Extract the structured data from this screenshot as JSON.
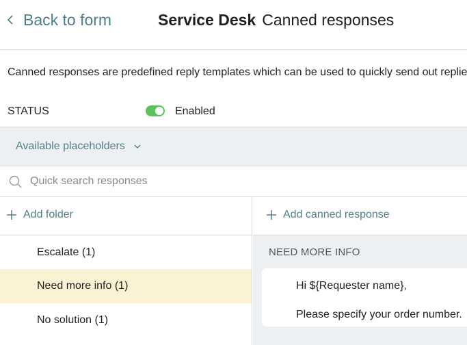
{
  "header": {
    "back_label": "Back to form",
    "product_name": "Service Desk",
    "page_title": "Canned responses"
  },
  "description": "Canned responses are predefined reply templates which can be used to quickly send out replies.",
  "status": {
    "label": "STATUS",
    "value": "Enabled",
    "enabled": true,
    "toggle_color": "#5cc15a"
  },
  "placeholders": {
    "label": "Available placeholders"
  },
  "search": {
    "placeholder": "Quick search responses",
    "value": ""
  },
  "folders": {
    "add_label": "Add folder",
    "items": [
      {
        "label": "Escalate (1)"
      },
      {
        "label": "Need more info (1)"
      },
      {
        "label": "No solution (1)"
      }
    ],
    "selected_index": 1
  },
  "responses": {
    "add_label": "Add canned response",
    "folder_heading": "NEED MORE INFO",
    "items": [
      {
        "line1": "Hi ${Requester name},",
        "line2": "Please specify your order number."
      }
    ]
  },
  "colors": {
    "accent": "#4f7f86",
    "selected_row": "#faf2d3",
    "panel_bg": "#edf0f3"
  },
  "icons": [
    "chevron-left-icon",
    "chevron-down-icon",
    "search-icon",
    "plus-icon"
  ]
}
